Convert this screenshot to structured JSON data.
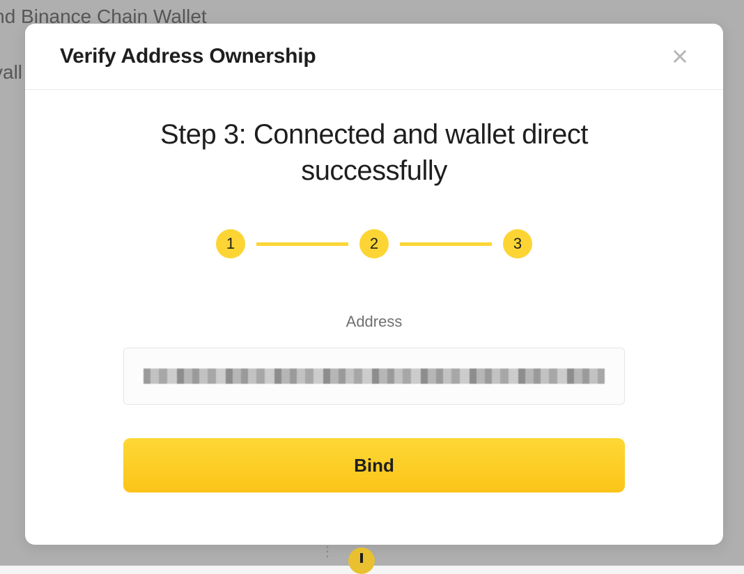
{
  "background": {
    "text1": "t and Binance Chain Wallet",
    "text2": "vall"
  },
  "modal": {
    "title": "Verify Address Ownership",
    "step_heading": "Step 3: Connected and wallet direct successfully",
    "stepper": {
      "steps": [
        "1",
        "2",
        "3"
      ]
    },
    "address_label": "Address",
    "address_value": "",
    "bind_button": "Bind"
  }
}
